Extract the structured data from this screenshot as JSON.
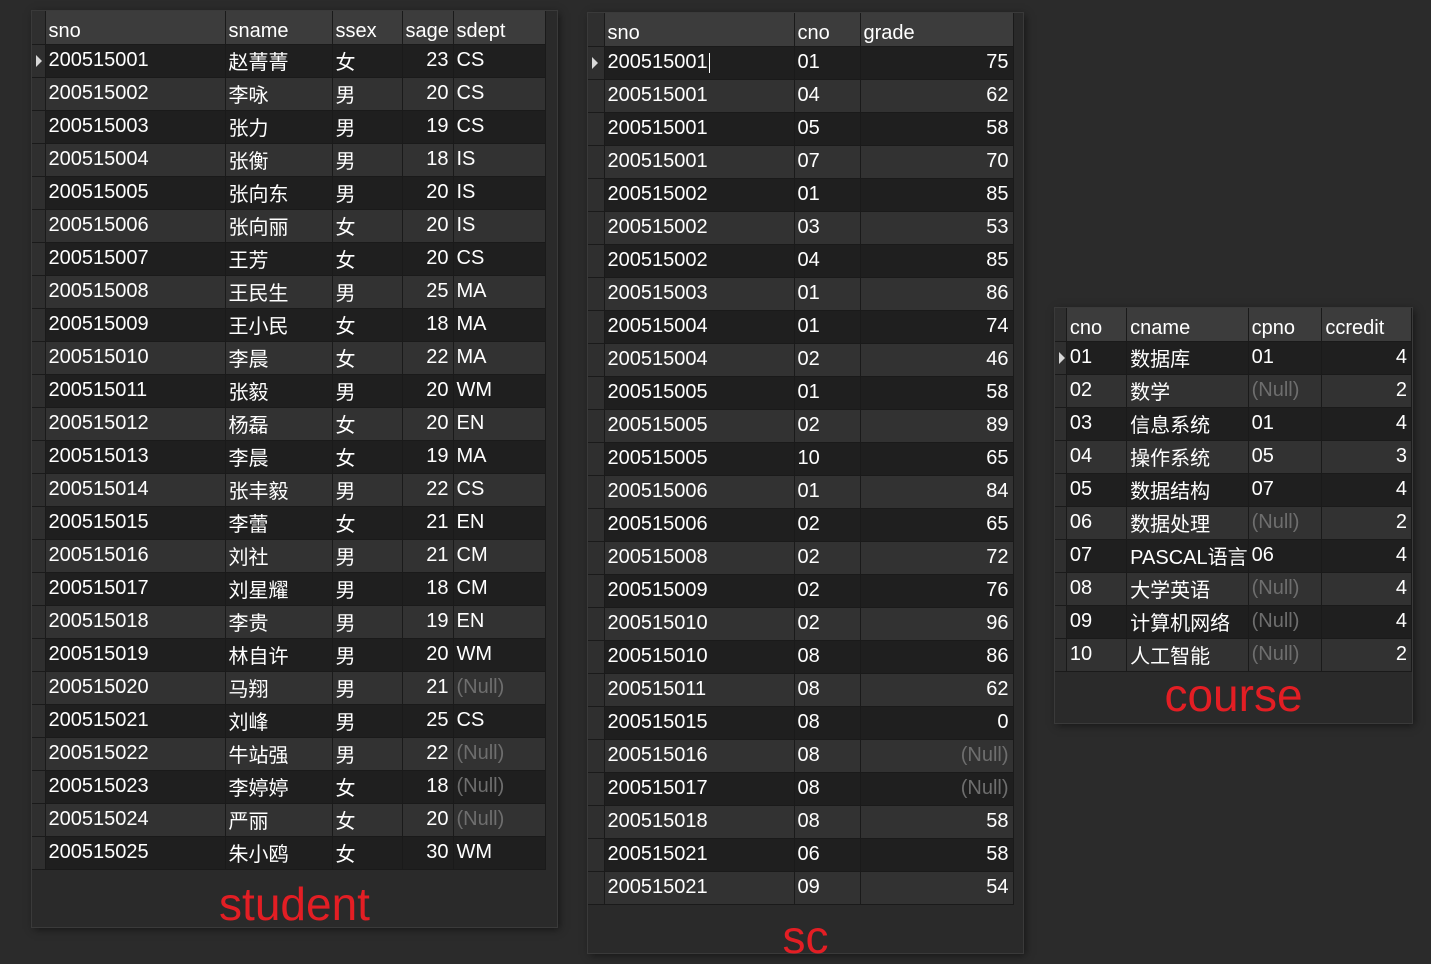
{
  "student": {
    "caption": "student",
    "columns": [
      "sno",
      "sname",
      "ssex",
      "sage",
      "sdept"
    ],
    "rows": [
      [
        "200515001",
        "赵菁菁",
        "女",
        "23",
        "CS"
      ],
      [
        "200515002",
        "李咏",
        "男",
        "20",
        "CS"
      ],
      [
        "200515003",
        "张力",
        "男",
        "19",
        "CS"
      ],
      [
        "200515004",
        "张衡",
        "男",
        "18",
        "IS"
      ],
      [
        "200515005",
        "张向东",
        "男",
        "20",
        "IS"
      ],
      [
        "200515006",
        "张向丽",
        "女",
        "20",
        "IS"
      ],
      [
        "200515007",
        "王芳",
        "女",
        "20",
        "CS"
      ],
      [
        "200515008",
        "王民生",
        "男",
        "25",
        "MA"
      ],
      [
        "200515009",
        "王小民",
        "女",
        "18",
        "MA"
      ],
      [
        "200515010",
        "李晨",
        "女",
        "22",
        "MA"
      ],
      [
        "200515011",
        "张毅",
        "男",
        "20",
        "WM"
      ],
      [
        "200515012",
        "杨磊",
        "女",
        "20",
        "EN"
      ],
      [
        "200515013",
        "李晨",
        "女",
        "19",
        "MA"
      ],
      [
        "200515014",
        "张丰毅",
        "男",
        "22",
        "CS"
      ],
      [
        "200515015",
        "李蕾",
        "女",
        "21",
        "EN"
      ],
      [
        "200515016",
        "刘社",
        "男",
        "21",
        "CM"
      ],
      [
        "200515017",
        "刘星耀",
        "男",
        "18",
        "CM"
      ],
      [
        "200515018",
        "李贵",
        "男",
        "19",
        "EN"
      ],
      [
        "200515019",
        "林自许",
        "男",
        "20",
        "WM"
      ],
      [
        "200515020",
        "马翔",
        "男",
        "21",
        "(Null)"
      ],
      [
        "200515021",
        "刘峰",
        "男",
        "25",
        "CS"
      ],
      [
        "200515022",
        "牛站强",
        "男",
        "22",
        "(Null)"
      ],
      [
        "200515023",
        "李婷婷",
        "女",
        "18",
        "(Null)"
      ],
      [
        "200515024",
        "严丽",
        "女",
        "20",
        "(Null)"
      ],
      [
        "200515025",
        "朱小鸥",
        "女",
        "30",
        "WM"
      ]
    ]
  },
  "sc": {
    "caption": "sc",
    "columns": [
      "sno",
      "cno",
      "grade"
    ],
    "rows": [
      [
        "200515001",
        "01",
        "75"
      ],
      [
        "200515001",
        "04",
        "62"
      ],
      [
        "200515001",
        "05",
        "58"
      ],
      [
        "200515001",
        "07",
        "70"
      ],
      [
        "200515002",
        "01",
        "85"
      ],
      [
        "200515002",
        "03",
        "53"
      ],
      [
        "200515002",
        "04",
        "85"
      ],
      [
        "200515003",
        "01",
        "86"
      ],
      [
        "200515004",
        "01",
        "74"
      ],
      [
        "200515004",
        "02",
        "46"
      ],
      [
        "200515005",
        "01",
        "58"
      ],
      [
        "200515005",
        "02",
        "89"
      ],
      [
        "200515005",
        "10",
        "65"
      ],
      [
        "200515006",
        "01",
        "84"
      ],
      [
        "200515006",
        "02",
        "65"
      ],
      [
        "200515008",
        "02",
        "72"
      ],
      [
        "200515009",
        "02",
        "76"
      ],
      [
        "200515010",
        "02",
        "96"
      ],
      [
        "200515010",
        "08",
        "86"
      ],
      [
        "200515011",
        "08",
        "62"
      ],
      [
        "200515015",
        "08",
        "0"
      ],
      [
        "200515016",
        "08",
        "(Null)"
      ],
      [
        "200515017",
        "08",
        "(Null)"
      ],
      [
        "200515018",
        "08",
        "58"
      ],
      [
        "200515021",
        "06",
        "58"
      ],
      [
        "200515021",
        "09",
        "54"
      ]
    ]
  },
  "course": {
    "caption": "course",
    "columns": [
      "cno",
      "cname",
      "cpno",
      "ccredit"
    ],
    "rows": [
      [
        "01",
        "数据库",
        "01",
        "4"
      ],
      [
        "02",
        "数学",
        "(Null)",
        "2"
      ],
      [
        "03",
        "信息系统",
        "01",
        "4"
      ],
      [
        "04",
        "操作系统",
        "05",
        "3"
      ],
      [
        "05",
        "数据结构",
        "07",
        "4"
      ],
      [
        "06",
        "数据处理",
        "(Null)",
        "2"
      ],
      [
        "07",
        "PASCAL语言",
        "06",
        "4"
      ],
      [
        "08",
        "大学英语",
        "(Null)",
        "4"
      ],
      [
        "09",
        "计算机网络",
        "(Null)",
        "4"
      ],
      [
        "10",
        "人工智能",
        "(Null)",
        "2"
      ]
    ]
  },
  "colors": {
    "background": "#2b2b2b",
    "header": "#3c3c3c",
    "row_even": "#1f1f1f",
    "row_odd": "#323232",
    "null_text": "#6e6e6e",
    "caption": "#e31e24"
  }
}
